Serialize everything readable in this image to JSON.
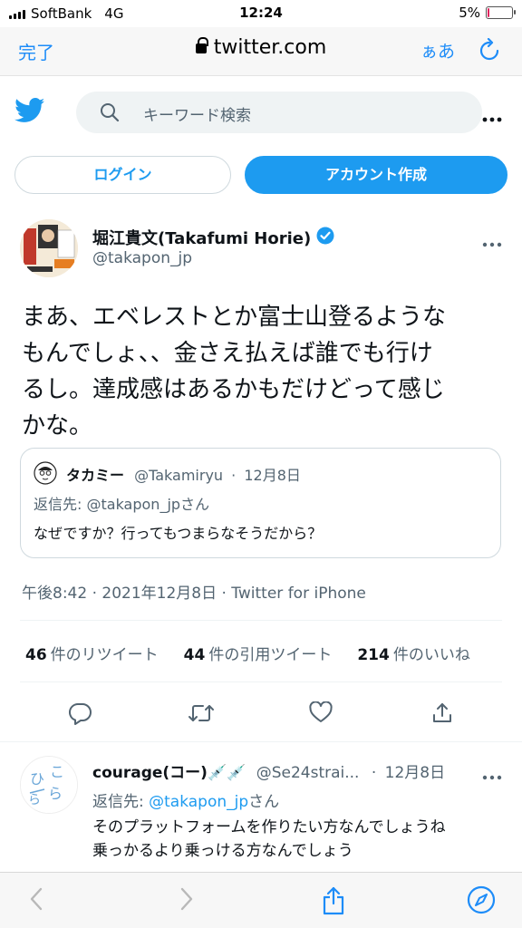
{
  "status_bar": {
    "carrier": "SoftBank",
    "network": "4G",
    "time": "12:24",
    "battery_text": "5%",
    "battery_level": 0.05
  },
  "browser": {
    "done_label": "完了",
    "url": "twitter.com",
    "text_size_label": "ぁあ"
  },
  "header": {
    "search_placeholder": "キーワード検索"
  },
  "auth": {
    "login_label": "ログイン",
    "signup_label": "アカウント作成"
  },
  "tweet": {
    "author_name": "堀江貴文(Takafumi Horie)",
    "author_handle": "@takapon_jp",
    "text_lines": [
      "まあ、エベレストとか富士山登るような",
      "もんでしょ、、金さえ払えば誰でも行け",
      "るし。達成感はあるかもだけどって感じ",
      "かな。"
    ],
    "quote": {
      "name": "タカミー",
      "handle": "@Takamiryu",
      "dot": "·",
      "date": "12月8日",
      "reply_to_prefix": "返信先: ",
      "reply_to_handle": "@takapon_jp",
      "reply_to_suffix": "さん",
      "text": "なぜですか？行ってもつまらなそうだから？"
    },
    "meta": "午後8:42 · 2021年12月8日 · Twitter for iPhone",
    "stats": {
      "retweets_count": "46",
      "retweets_label": "件のリツイート",
      "quotes_count": "44",
      "quotes_label": "件の引用ツイート",
      "likes_count": "214",
      "likes_label": "件のいいね"
    }
  },
  "reply": {
    "name": "courage(コー)💉💉",
    "handle": "@Se24strai...",
    "dot": "·",
    "date": "12月8日",
    "reply_to_prefix": "返信先: ",
    "reply_to_handle": "@takapon_jp",
    "reply_to_suffix": "さん",
    "text_lines": [
      "そのプラットフォームを作りたい方なんでしょうね",
      "乗っかるより乗っける方なんでしょう"
    ]
  },
  "colors": {
    "twitter_blue": "#1d9bf0",
    "safari_blue": "#1d8cf8",
    "secondary_text": "#536471",
    "battery_low": "#e0245e"
  }
}
